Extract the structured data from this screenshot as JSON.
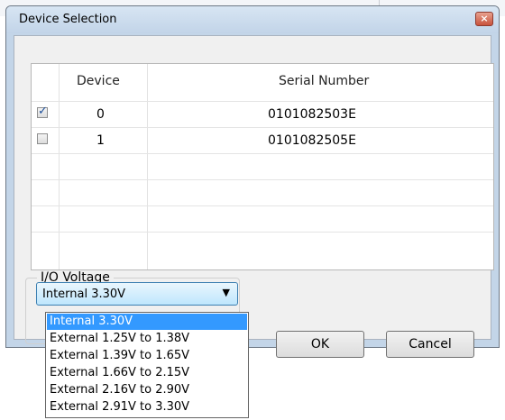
{
  "dialog": {
    "title": "Device Selection",
    "close_icon": "×"
  },
  "grid": {
    "columns": [
      "Device",
      "Serial Number"
    ],
    "rows": [
      {
        "checked": true,
        "device": "0",
        "serial": "0101082503E"
      },
      {
        "checked": false,
        "device": "1",
        "serial": "0101082505E"
      }
    ]
  },
  "io_voltage": {
    "label": "I/O Voltage",
    "selected": "Internal 3.30V",
    "options": [
      "Internal 3.30V",
      "External 1.25V to 1.38V",
      "External 1.39V to 1.65V",
      "External 1.66V to 2.15V",
      "External 2.16V to 2.90V",
      "External 2.91V to 3.30V"
    ]
  },
  "buttons": {
    "ok": "OK",
    "cancel": "Cancel"
  },
  "colors": {
    "selection": "#3399ff",
    "check": "#1d4f9a"
  }
}
